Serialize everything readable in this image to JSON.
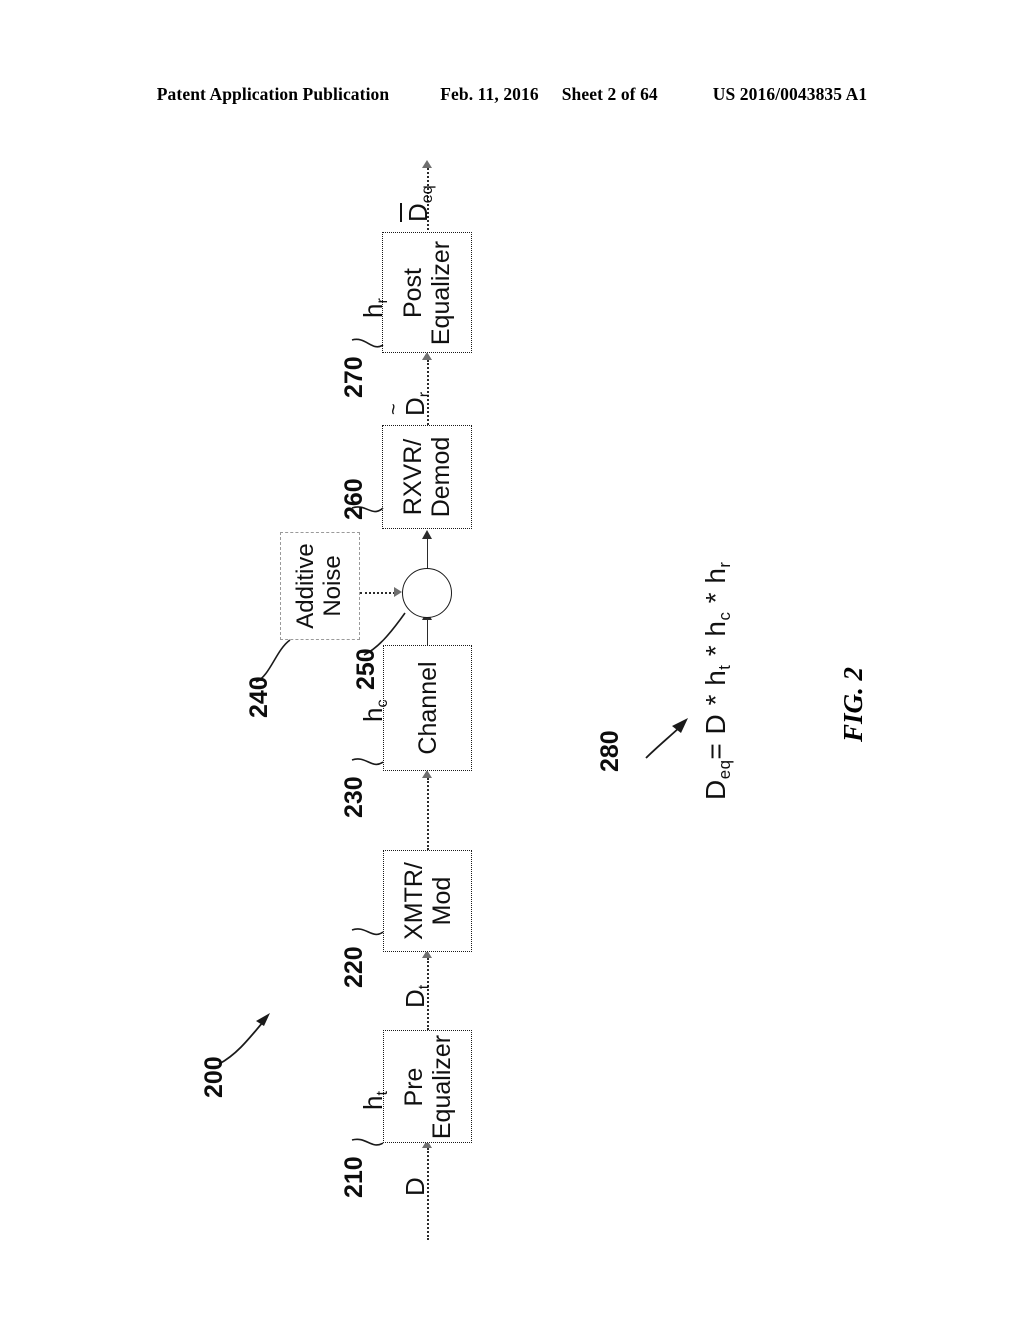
{
  "header": {
    "publication": "Patent Application Publication",
    "date": "Feb. 11, 2016",
    "sheet": "Sheet 2 of 64",
    "patent_number": "US 2016/0043835 A1"
  },
  "figure": {
    "caption": "FIG. 2",
    "system_ref": "200",
    "blocks": [
      {
        "id": "pre-equalizer",
        "label_line1": "Pre",
        "label_line2": "Equalizer",
        "ref": "210"
      },
      {
        "id": "xmtr-mod",
        "label_line1": "XMTR/",
        "label_line2": "Mod",
        "ref": "220"
      },
      {
        "id": "channel",
        "label_line1": "Channel",
        "label_line2": "",
        "ref": "230"
      },
      {
        "id": "additive-noise",
        "label_line1": "Additive",
        "label_line2": "Noise",
        "ref": "240"
      },
      {
        "id": "summing-node",
        "label_line1": "",
        "label_line2": "",
        "ref": "250"
      },
      {
        "id": "rxvr-demod",
        "label_line1": "RXVR/",
        "label_line2": "Demod",
        "ref": "260"
      },
      {
        "id": "post-equalizer",
        "label_line1": "Post",
        "label_line2": "Equalizer",
        "ref": "270"
      }
    ],
    "signals": {
      "input": "D",
      "pre_eq_response": "h",
      "pre_eq_response_sub": "t",
      "transmitted": "D",
      "transmitted_sub": "t",
      "channel_response": "h",
      "channel_response_sub": "c",
      "received": "D",
      "received_sub": "r",
      "post_eq_response": "h",
      "post_eq_response_sub": "r",
      "output": "D",
      "output_sub": "eq"
    },
    "equation": {
      "ref": "280",
      "lhs": "D",
      "lhs_sub": "eq",
      "rhs_text": "= D * h",
      "term1_sub": "t",
      "op1": " * h",
      "term2_sub": "c",
      "op2": " * h",
      "term3_sub": "r",
      "full": "Deq = D * ht * hc * hr"
    }
  }
}
